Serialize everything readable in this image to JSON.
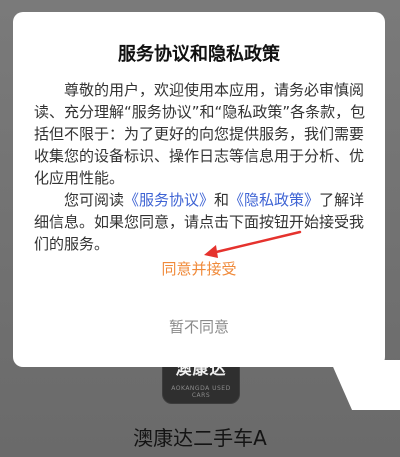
{
  "dialog": {
    "title": "服务协议和隐私政策",
    "paragraph1": "尊敬的用户，欢迎使用本应用，请务必审慎阅读、充分理解“服务协议”和“隐私政策”各条款，包括但不限于：为了更好的向您提供服务，我们需要收集您的设备标识、操作日志等信息用于分析、优化应用性能。",
    "paragraph2_prefix": "您可阅读",
    "service_link": "《服务协议》",
    "paragraph2_and": "和",
    "privacy_link": "《隐私政策》",
    "paragraph2_suffix": "了解详细信息。如果您同意，请点击下面按钮开始接受我们的服务。",
    "agree_label": "同意并接受",
    "disagree_label": "暂不同意"
  },
  "app": {
    "icon_text": "澳康达",
    "icon_subtext": "AOKANGDA USED CARS",
    "name": "澳康达二手车A"
  },
  "colors": {
    "link": "#3f64d4",
    "agree": "#f08a3a",
    "disagree": "#8a8a8a",
    "annotation_arrow": "#e5322d"
  }
}
